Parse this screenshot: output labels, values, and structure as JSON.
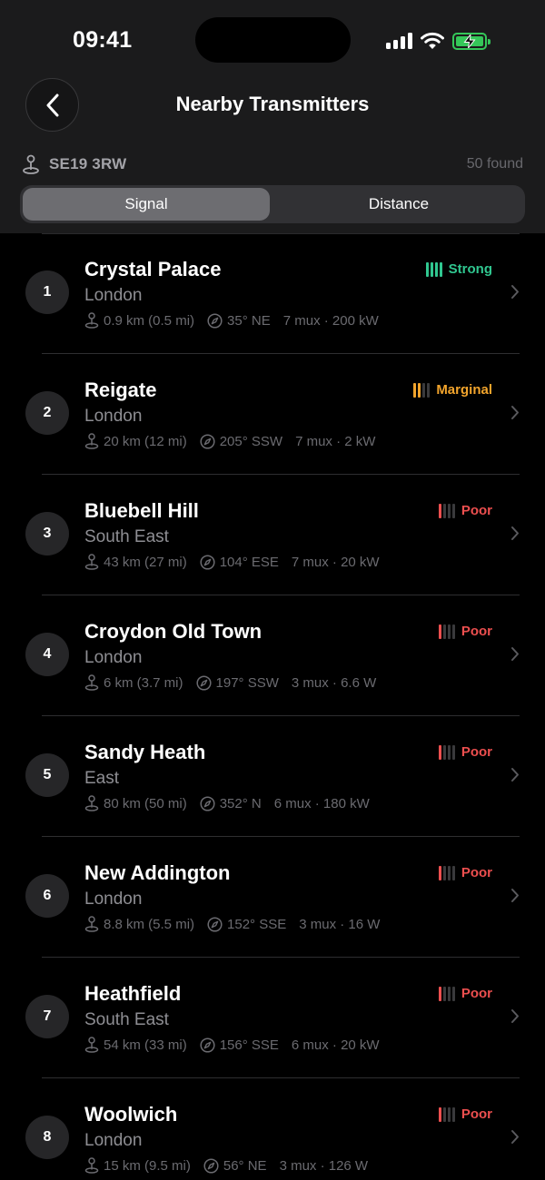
{
  "status_bar": {
    "time": "09:41"
  },
  "nav": {
    "title": "Nearby Transmitters"
  },
  "location": {
    "postcode": "SE19 3RW",
    "found": "50 found"
  },
  "segments": {
    "signal": "Signal",
    "distance": "Distance",
    "selected": "Signal"
  },
  "colors": {
    "strong": "#30c790",
    "marginal": "#f2a42c",
    "poor": "#ec4f4f",
    "battery": "#35c759"
  },
  "transmitters": [
    {
      "rank": "1",
      "name": "Crystal Palace",
      "region": "London",
      "distance": "0.9 km (0.5 mi)",
      "bearing": "35° NE",
      "info": "7 mux · 200 kW",
      "signal": "Strong",
      "level": 4
    },
    {
      "rank": "2",
      "name": "Reigate",
      "region": "London",
      "distance": "20 km (12 mi)",
      "bearing": "205° SSW",
      "info": "7 mux · 2 kW",
      "signal": "Marginal",
      "level": 2
    },
    {
      "rank": "3",
      "name": "Bluebell Hill",
      "region": "South East",
      "distance": "43 km (27 mi)",
      "bearing": "104° ESE",
      "info": "7 mux · 20 kW",
      "signal": "Poor",
      "level": 1
    },
    {
      "rank": "4",
      "name": "Croydon Old Town",
      "region": "London",
      "distance": "6 km (3.7 mi)",
      "bearing": "197° SSW",
      "info": "3 mux · 6.6 W",
      "signal": "Poor",
      "level": 1
    },
    {
      "rank": "5",
      "name": "Sandy Heath",
      "region": "East",
      "distance": "80 km (50 mi)",
      "bearing": "352° N",
      "info": "6 mux · 180 kW",
      "signal": "Poor",
      "level": 1
    },
    {
      "rank": "6",
      "name": "New Addington",
      "region": "London",
      "distance": "8.8 km (5.5 mi)",
      "bearing": "152° SSE",
      "info": "3 mux · 16 W",
      "signal": "Poor",
      "level": 1
    },
    {
      "rank": "7",
      "name": "Heathfield",
      "region": "South East",
      "distance": "54 km (33 mi)",
      "bearing": "156° SSE",
      "info": "6 mux · 20 kW",
      "signal": "Poor",
      "level": 1
    },
    {
      "rank": "8",
      "name": "Woolwich",
      "region": "London",
      "distance": "15 km (9.5 mi)",
      "bearing": "56° NE",
      "info": "3 mux · 126 W",
      "signal": "Poor",
      "level": 1
    }
  ]
}
